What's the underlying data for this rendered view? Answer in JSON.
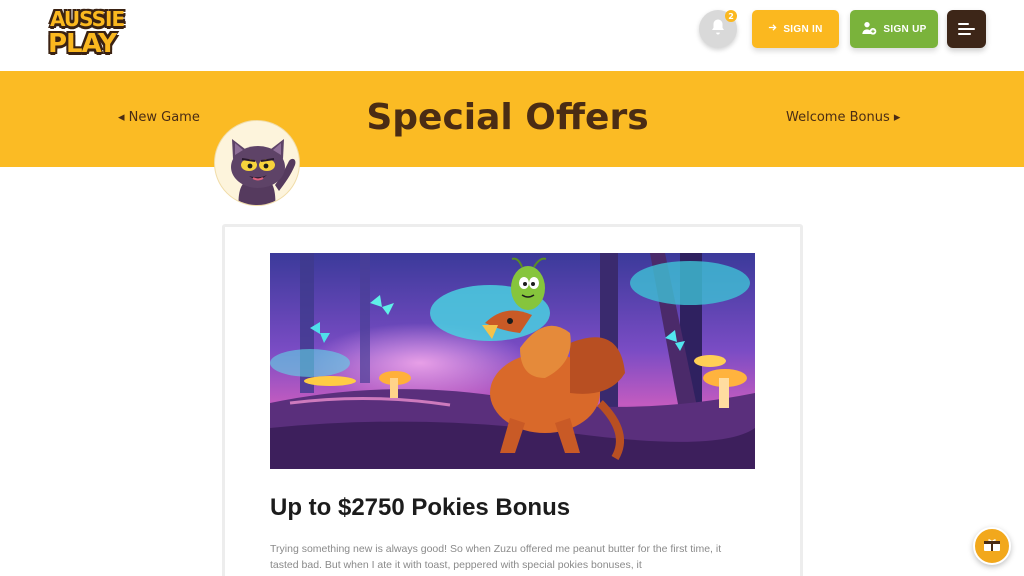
{
  "header": {
    "logo_line1": "AUSSIE",
    "logo_line2": "PLAY",
    "notification_count": "2",
    "sign_in_label": "SIGN IN",
    "sign_up_label": "SIGN UP"
  },
  "banner": {
    "title": "Special Offers",
    "prev_label": "◂ New Game",
    "next_label": "Welcome Bonus ▸"
  },
  "offer": {
    "title": "Up to $2750 Pokies Bonus",
    "text": "Trying something new is always good! So when Zuzu offered me peanut butter for the first time, it tasted bad. But when I ate it with toast, peppered with special pokies bonuses, it"
  },
  "icons": {
    "bell": "bell-icon",
    "sign_in": "arrow-right-icon",
    "sign_up": "add-user-icon",
    "menu": "hamburger-icon",
    "float": "gift-icon"
  },
  "colors": {
    "brand_yellow": "#fbbb24",
    "brand_green": "#7ab33b",
    "brand_brown": "#4a2c14"
  }
}
